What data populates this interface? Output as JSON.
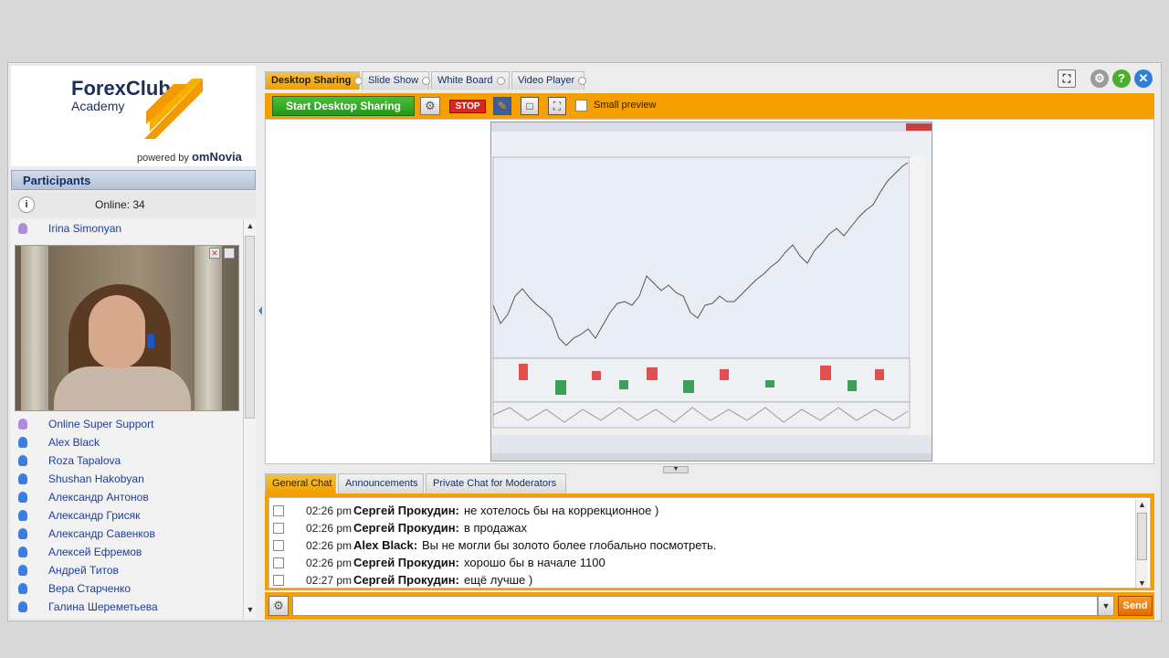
{
  "logo": {
    "brand": "ForexClub",
    "sub": "Academy",
    "powered_prefix": "powered by",
    "powered_brand": "omNovia"
  },
  "participants": {
    "title": "Participants",
    "online_label": "Online:  34",
    "presenter": "Irina Simonyan",
    "items": [
      {
        "name": "Online Super Support",
        "color": "#b08be0"
      },
      {
        "name": "Alex Black",
        "color": "#3a7fe0"
      },
      {
        "name": "Roza Tapalova",
        "color": "#3a7fe0"
      },
      {
        "name": "Shushan Hakobyan",
        "color": "#3a7fe0"
      },
      {
        "name": "Александр Антонов",
        "color": "#3a7fe0"
      },
      {
        "name": "Александр Грисяк",
        "color": "#3a7fe0"
      },
      {
        "name": "Александр Савенков",
        "color": "#3a7fe0"
      },
      {
        "name": "Алексей Ефремов",
        "color": "#3a7fe0"
      },
      {
        "name": "Андрей Титов",
        "color": "#3a7fe0"
      },
      {
        "name": "Вера Старченко",
        "color": "#3a7fe0"
      },
      {
        "name": "Галина Шереметьева",
        "color": "#3a7fe0"
      }
    ]
  },
  "tabs": [
    "Desktop Sharing",
    "Slide Show",
    "White Board",
    "Video Player"
  ],
  "toolbar": {
    "start": "Start Desktop Sharing",
    "stop": "STOP",
    "small_preview": "Small preview"
  },
  "chat_tabs": [
    "General Chat",
    "Announcements",
    "Private Chat for Moderators"
  ],
  "chat": [
    {
      "time": "02:26 pm",
      "user": "Сергей Прокудин:",
      "text": "не хотелось бы на коррекционное )"
    },
    {
      "time": "02:26 pm",
      "user": "Сергей Прокудин:",
      "text": "в продажах"
    },
    {
      "time": "02:26 pm",
      "user": "Alex Black:",
      "text": "Вы не могли бы золото более глобально посмотреть."
    },
    {
      "time": "02:26 pm",
      "user": "Сергей Прокудин:",
      "text": "хорошо бы в начале 1100"
    },
    {
      "time": "02:27 pm",
      "user": "Сергей Прокудин:",
      "text": "ещё лучше )"
    }
  ],
  "send_label": "Send",
  "colors": {
    "accent": "#f5a000",
    "header_blue": "#14306a",
    "start_green": "#2aa321",
    "stop_red": "#d9241f"
  }
}
